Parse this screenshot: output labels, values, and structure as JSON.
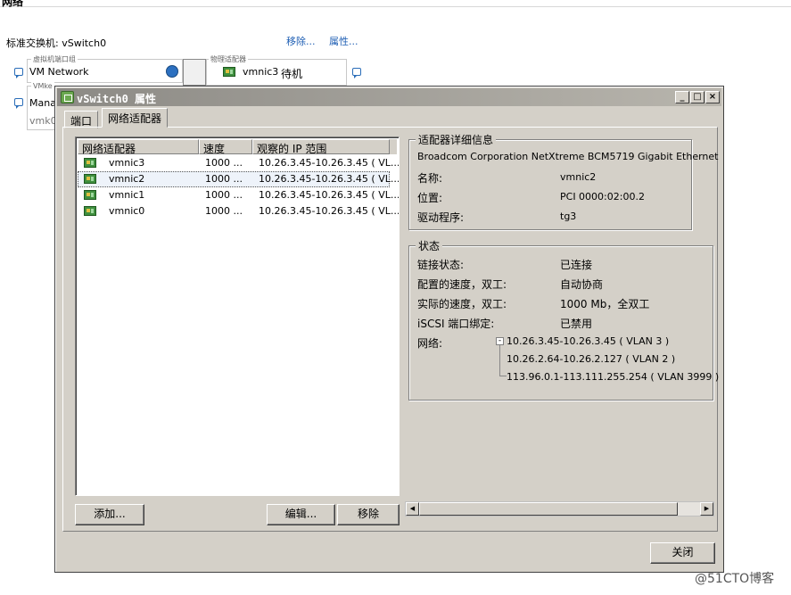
{
  "background": {
    "header_title": "网络",
    "switch_label": "标准交换机: vSwitch0",
    "remove_link": "移除...",
    "props_link": "属性...",
    "vm_group_legend": "虚拟机端口组",
    "vm_network": "VM Network",
    "phys_legend": "物理适配器",
    "phys_nic": "vmnic3",
    "phys_state": "待机",
    "phys_state2": "待机",
    "vmk_legend": "VMke",
    "vmk_label": "Mana",
    "vmk_id": "vmk0"
  },
  "dialog": {
    "title": "vSwitch0 属性",
    "tabs": [
      {
        "label": "端口"
      },
      {
        "label": "网络适配器"
      }
    ],
    "list": {
      "columns": [
        "网络适配器",
        "速度",
        "观察的 IP 范围"
      ],
      "rows": [
        {
          "name": "vmnic3",
          "speed": "1000 ...",
          "range": "10.26.3.45-10.26.3.45 ( VL..."
        },
        {
          "name": "vmnic2",
          "speed": "1000 ...",
          "range": "10.26.3.45-10.26.3.45 ( VL..."
        },
        {
          "name": "vmnic1",
          "speed": "1000 ...",
          "range": "10.26.3.45-10.26.3.45 ( VL..."
        },
        {
          "name": "vmnic0",
          "speed": "1000 ...",
          "range": "10.26.3.45-10.26.3.45 ( VL..."
        }
      ],
      "selected_index": 1
    },
    "buttons": {
      "add": "添加...",
      "edit": "编辑...",
      "remove": "移除",
      "close": "关闭"
    },
    "details": {
      "legend": "适配器详细信息",
      "adapter": "Broadcom Corporation NetXtreme BCM5719 Gigabit Ethernet",
      "name_label": "名称:",
      "name_value": "vmnic2",
      "location_label": "位置:",
      "location_value": "PCI 0000:02:00.2",
      "driver_label": "驱动程序:",
      "driver_value": "tg3"
    },
    "status": {
      "legend": "状态",
      "link_label": "链接状态:",
      "link_value": "已连接",
      "config_label": "配置的速度，双工:",
      "config_value": "自动协商",
      "actual_label": "实际的速度，双工:",
      "actual_value": "1000 Mb，全双工",
      "iscsi_label": "iSCSI 端口绑定:",
      "iscsi_value": "已禁用",
      "network_label": "网络:",
      "networks": [
        "10.26.3.45-10.26.3.45 ( VLAN 3 )",
        "10.26.2.64-10.26.2.127 ( VLAN 2 )",
        "113.96.0.1-113.111.255.254 ( VLAN 3999 )"
      ]
    }
  },
  "watermark": "@51CTO博客"
}
